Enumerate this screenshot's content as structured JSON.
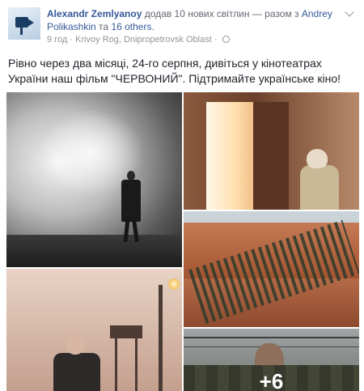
{
  "post": {
    "author": "Alexandr Zemlyanoy",
    "action": "додав 10 нових світлин — разом з",
    "tagged_first": "Andrey Polikashkin",
    "conjunction": "та",
    "tagged_others": "16 others",
    "time": "9 год",
    "location": "Krivoy Rog, Dnipropetrovsk Oblast",
    "text": "Рівно через два місяці, 24-го серпня, дивіться у кінотеатрах України наш фільм \"ЧЕРВОНИЙ\". Підтримайте українське кіно!"
  },
  "gallery": {
    "more_count": "+6"
  },
  "icons": {
    "avatar": "avatar-camera",
    "privacy": "globe-icon",
    "menu": "chevron-down-icon"
  }
}
